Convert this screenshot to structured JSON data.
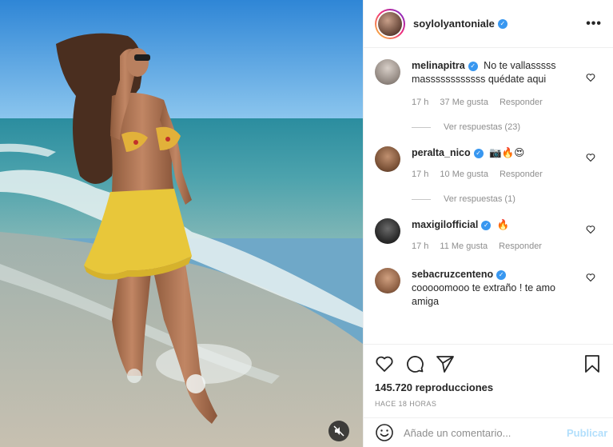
{
  "post": {
    "username": "soylolyantoniale",
    "verified": true,
    "more_icon": "more-horizontal-icon"
  },
  "comments": [
    {
      "username": "melinapitra",
      "verified": true,
      "text": "No te vallasssss massssssssssss quédate aqui",
      "time": "17 h",
      "likes": "37 Me gusta",
      "reply": "Responder",
      "replies": "Ver respuestas (23)"
    },
    {
      "username": "peralta_nico",
      "verified": true,
      "text": "📷🔥😍",
      "time": "17 h",
      "likes": "10 Me gusta",
      "reply": "Responder",
      "replies": "Ver respuestas (1)"
    },
    {
      "username": "maxigilofficial",
      "verified": true,
      "text": "🔥",
      "time": "17 h",
      "likes": "11 Me gusta",
      "reply": "Responder"
    },
    {
      "username": "sebacruzcenteno",
      "verified": true,
      "text": "cooooomooo te extraño ! te amo amiga"
    }
  ],
  "stats": {
    "views": "145.720 reproducciones",
    "posted": "HACE 18 HORAS"
  },
  "composer": {
    "placeholder": "Añade un comentario...",
    "publish": "Publicar"
  },
  "colors": {
    "accent": "#3897f0",
    "publish_disabled": "#b2dffc",
    "muted": "#8e8e8e"
  }
}
